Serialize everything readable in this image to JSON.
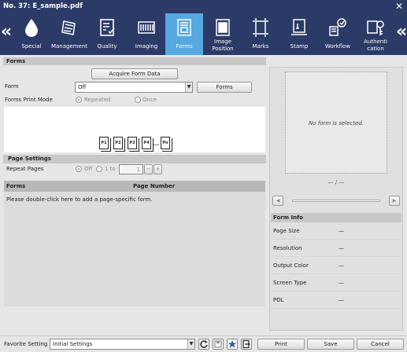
{
  "window": {
    "title": "No. 37: E_sample.pdf"
  },
  "ribbon": {
    "tabs": [
      {
        "label": "Special",
        "icon": "drop-icon"
      },
      {
        "label": "Management",
        "icon": "paper-stack-icon"
      },
      {
        "label": "Quality",
        "icon": "checklist-icon"
      },
      {
        "label": "Imaging",
        "icon": "image-strip-icon"
      },
      {
        "label": "Forms",
        "icon": "form-icon"
      },
      {
        "label": "Image Position",
        "icon": "position-icon"
      },
      {
        "label": "Marks",
        "icon": "crop-marks-icon"
      },
      {
        "label": "Stamp",
        "icon": "stamp-icon"
      },
      {
        "label": "Workflow",
        "icon": "workflow-icon"
      },
      {
        "label": "Authentication",
        "icon": "key-icon"
      }
    ],
    "tab_labels": {
      "image_position_line1": "Image",
      "image_position_line2": "Position",
      "auth_line1": "Authenti",
      "auth_line2": "cation"
    },
    "active_tab": "Forms",
    "accent_color": "#57a7e0",
    "bar_color": "#2b3a66"
  },
  "forms": {
    "section_title": "Forms",
    "acquire_button": "Acquire Form Data",
    "form_label": "Form",
    "form_value": "Off",
    "forms_button": "Forms",
    "print_mode_label": "Forms Print Mode",
    "print_mode_options": [
      "Repeated",
      "Once"
    ],
    "print_mode_selected": "Repeated",
    "pages": [
      "P1",
      "P2",
      "P3",
      "P4",
      "Pn"
    ],
    "ellipsis": "..."
  },
  "page_settings": {
    "title": "Page Settings",
    "repeat_label": "Repeat Pages",
    "opt_off": "Off",
    "opt_one": "1 to",
    "stepper_value": "1",
    "minus": "−",
    "plus": "+",
    "table_headers": [
      "Forms",
      "Page Number"
    ],
    "hint": "Please double-click here to add a page-specific form."
  },
  "preview": {
    "empty_text": "No form is selected.",
    "page_indicator": "— / —"
  },
  "form_info": {
    "title": "Form Info",
    "rows": [
      {
        "label": "Page Size",
        "value": "—"
      },
      {
        "label": "Resolution",
        "value": "—"
      },
      {
        "label": "Output Color",
        "value": "—"
      },
      {
        "label": "Screen Type",
        "value": "—"
      },
      {
        "label": "PDL",
        "value": "—"
      }
    ]
  },
  "footer": {
    "favorite_label": "Favorite Setting",
    "favorite_value": "Initial Settings",
    "print_button": "Print",
    "save_button": "Save",
    "cancel_button": "Cancel"
  }
}
